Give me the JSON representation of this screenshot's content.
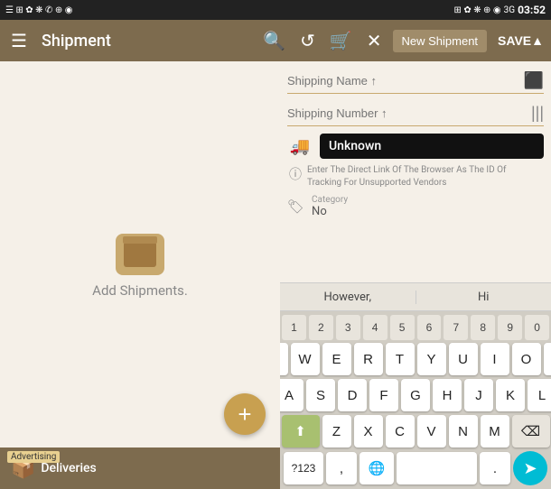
{
  "statusBar": {
    "leftIcons": "☰ ⊞ ✿ ❋ ✆ ⊕ ◉",
    "signal": "3G",
    "time": "03:52",
    "rightIcons": "☰ ⊞ ✿ ❋ ⊕ ◉",
    "rightSignal": "3G",
    "rightTime": "03:52"
  },
  "appBar": {
    "title": "Shipment",
    "newShipmentLabel": "New Shipment",
    "saveLabel": "SAVE▲"
  },
  "leftPanel": {
    "addShipmentsText": "Add Shipments."
  },
  "fab": {
    "label": "+"
  },
  "bottomNav": {
    "advertisingBadge": "Advertising",
    "deliveriesLabel": "Deliveries"
  },
  "form": {
    "shippingNameLabel": "Shipping Name ↑",
    "shippingNumberLabel": "Shipping Number ↑",
    "unknownValue": "Unknown",
    "infoText": "Enter The Direct Link Of The Browser As The ID Of Tracking For Unsupported Vendors",
    "categoryLabel": "Category",
    "categoryValue": "No"
  },
  "autocomplete": {
    "item1": "However,",
    "item2": "Hi"
  },
  "keyboard": {
    "numbersRow": [
      "1",
      "2",
      "3",
      "4",
      "5",
      "6",
      "7",
      "8",
      "9",
      "0"
    ],
    "row1": [
      "Q",
      "W",
      "E",
      "R",
      "T",
      "Y",
      "U",
      "I",
      "O",
      "P"
    ],
    "row2": [
      "A",
      "S",
      "D",
      "F",
      "G",
      "H",
      "J",
      "K",
      "L"
    ],
    "row3": [
      "Z",
      "X",
      "C",
      "V",
      "N",
      "M"
    ],
    "shiftLabel": "⬆",
    "deleteLabel": "⌫",
    "numLabel": "?123",
    "commaLabel": ",",
    "spaceLabel": "",
    "periodLabel": ".",
    "sendLabel": "➤"
  }
}
